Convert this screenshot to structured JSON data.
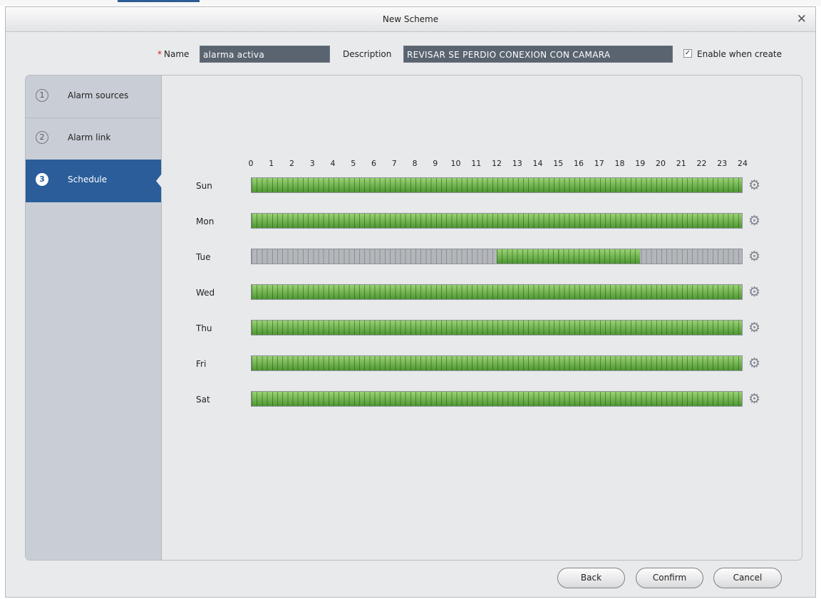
{
  "window": {
    "title": "New Scheme",
    "close_glyph": "✕"
  },
  "form": {
    "name_required_mark": "*",
    "name_label": "Name",
    "name_value": "alarma activa",
    "description_label": "Description",
    "description_value": "REVISAR SE PERDIO CONEXION CON CAMARA",
    "enable_checked": true,
    "enable_label": "Enable when create"
  },
  "steps": [
    {
      "num": "1",
      "label": "Alarm sources",
      "active": false
    },
    {
      "num": "2",
      "label": "Alarm link",
      "active": false
    },
    {
      "num": "3",
      "label": "Schedule",
      "active": true
    }
  ],
  "schedule": {
    "hour_labels": [
      "0",
      "1",
      "2",
      "3",
      "4",
      "5",
      "6",
      "7",
      "8",
      "9",
      "10",
      "11",
      "12",
      "13",
      "14",
      "15",
      "16",
      "17",
      "18",
      "19",
      "20",
      "21",
      "22",
      "23",
      "24"
    ],
    "days": [
      {
        "name": "Sun",
        "periods": [
          [
            0,
            24
          ]
        ]
      },
      {
        "name": "Mon",
        "periods": [
          [
            0,
            24
          ]
        ]
      },
      {
        "name": "Tue",
        "periods": [
          [
            12,
            19
          ]
        ]
      },
      {
        "name": "Wed",
        "periods": [
          [
            0,
            24
          ]
        ]
      },
      {
        "name": "Thu",
        "periods": [
          [
            0,
            24
          ]
        ]
      },
      {
        "name": "Fri",
        "periods": [
          [
            0,
            24
          ]
        ]
      },
      {
        "name": "Sat",
        "periods": [
          [
            0,
            24
          ]
        ]
      }
    ],
    "active_color": "#5fa83f",
    "inactive_color": "#b3b6bb",
    "settings_icon": "gear-icon"
  },
  "buttons": {
    "back": "Back",
    "confirm": "Confirm",
    "cancel": "Cancel"
  }
}
